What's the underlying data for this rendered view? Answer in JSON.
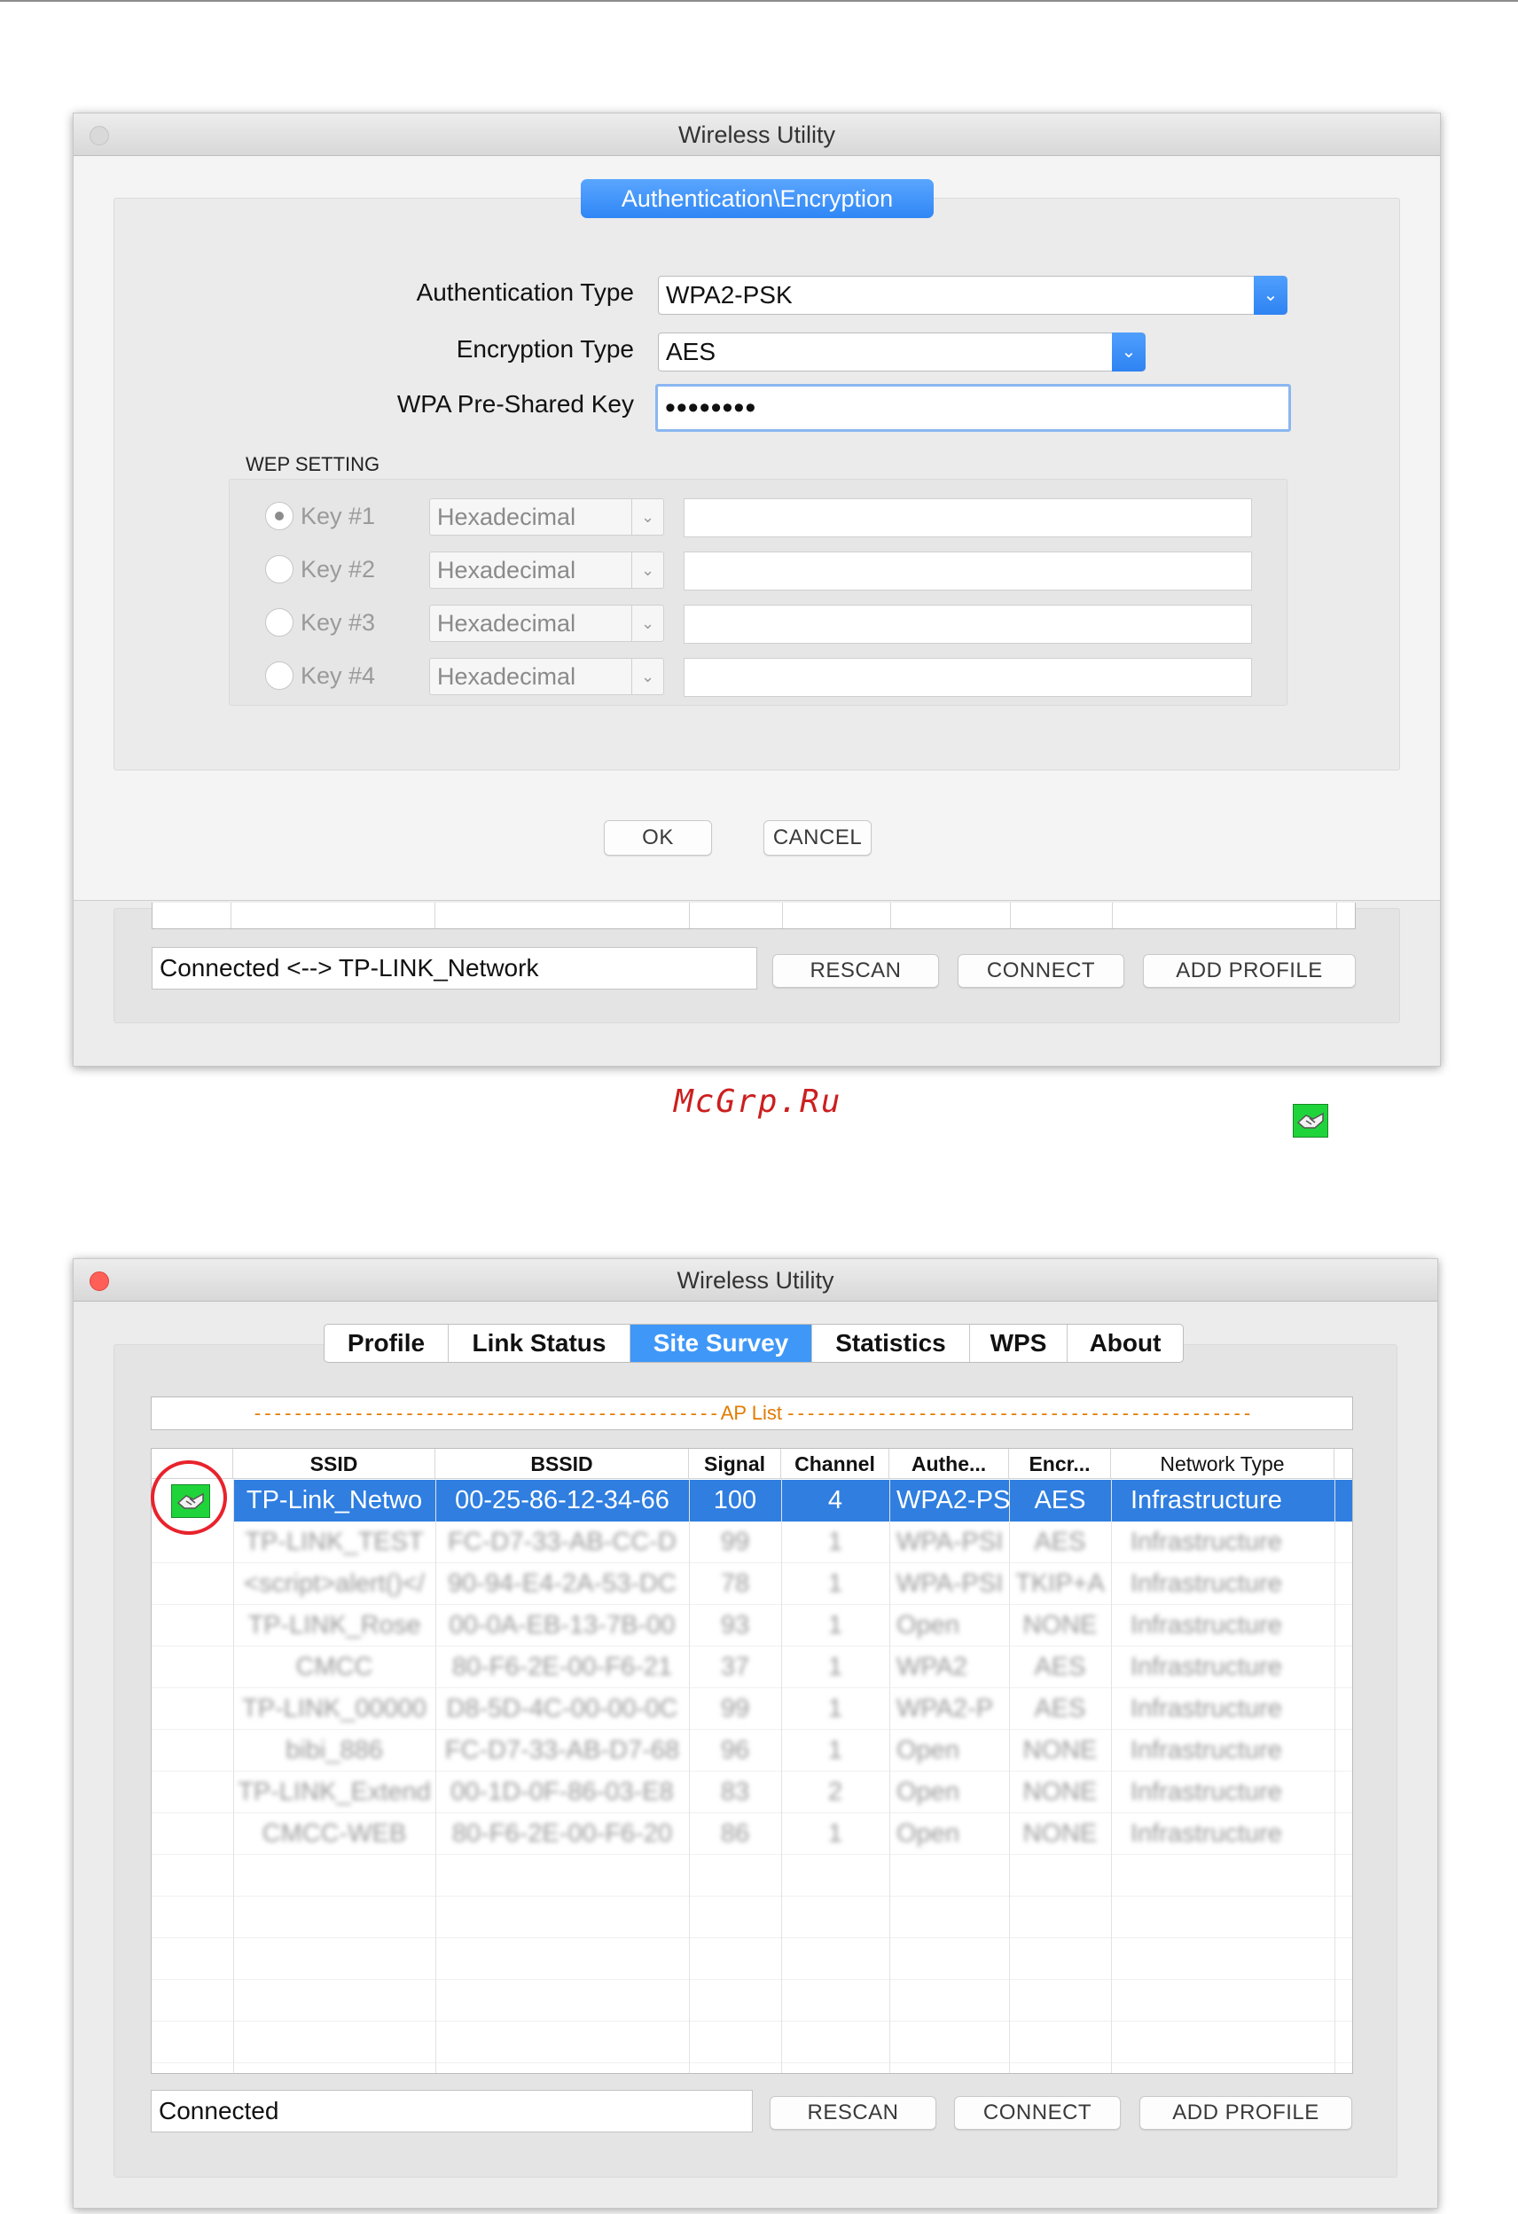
{
  "watermark": "McGrp.Ru",
  "auth_window": {
    "title": "Wireless Utility",
    "section_button": "Authentication\\Encryption",
    "fields": {
      "auth_type_label": "Authentication Type",
      "auth_type_value": "WPA2-PSK",
      "enc_type_label": "Encryption Type",
      "enc_type_value": "AES",
      "psk_label": "WPA Pre-Shared Key",
      "psk_value": "••••••••"
    },
    "wep": {
      "title": "WEP SETTING",
      "keys": [
        {
          "label": "Key #1",
          "format": "Hexadecimal",
          "selected": true,
          "value": ""
        },
        {
          "label": "Key #2",
          "format": "Hexadecimal",
          "selected": false,
          "value": ""
        },
        {
          "label": "Key #3",
          "format": "Hexadecimal",
          "selected": false,
          "value": ""
        },
        {
          "label": "Key #4",
          "format": "Hexadecimal",
          "selected": false,
          "value": ""
        }
      ]
    },
    "ok_label": "OK",
    "cancel_label": "CANCEL",
    "status_text": "Connected <--> TP-LINK_Network",
    "rescan_label": "RESCAN",
    "connect_label": "CONNECT",
    "add_profile_label": "ADD PROFILE"
  },
  "survey_window": {
    "title": "Wireless Utility",
    "tabs": [
      "Profile",
      "Link Status",
      "Site Survey",
      "Statistics",
      "WPS",
      "About"
    ],
    "active_tab": "Site Survey",
    "ap_list_label": "AP List",
    "columns": [
      "SSID",
      "BSSID",
      "Signal",
      "Channel",
      "Authe...",
      "Encr...",
      "Network Type"
    ],
    "rows": [
      {
        "connected": true,
        "ssid": "TP-Link_Netwo",
        "bssid": "00-25-86-12-34-66",
        "signal": "100",
        "channel": "4",
        "auth": "WPA2-PS",
        "enc": "AES",
        "type": "Infrastructure"
      },
      {
        "connected": false,
        "ssid": "TP-LINK_TEST",
        "bssid": "FC-D7-33-AB-CC-D",
        "signal": "99",
        "channel": "1",
        "auth": "WPA-PSI",
        "enc": "AES",
        "type": "Infrastructure"
      },
      {
        "connected": false,
        "ssid": "<script>alert()</",
        "bssid": "90-94-E4-2A-53-DC",
        "signal": "78",
        "channel": "1",
        "auth": "WPA-PSI",
        "enc": "TKIP+A",
        "type": "Infrastructure"
      },
      {
        "connected": false,
        "ssid": "TP-LINK_Rose",
        "bssid": "00-0A-EB-13-7B-00",
        "signal": "93",
        "channel": "1",
        "auth": "Open",
        "enc": "NONE",
        "type": "Infrastructure"
      },
      {
        "connected": false,
        "ssid": "CMCC",
        "bssid": "80-F6-2E-00-F6-21",
        "signal": "37",
        "channel": "1",
        "auth": "WPA2",
        "enc": "AES",
        "type": "Infrastructure"
      },
      {
        "connected": false,
        "ssid": "TP-LINK_00000",
        "bssid": "D8-5D-4C-00-00-0C",
        "signal": "99",
        "channel": "1",
        "auth": "WPA2-P",
        "enc": "AES",
        "type": "Infrastructure"
      },
      {
        "connected": false,
        "ssid": "bibi_886",
        "bssid": "FC-D7-33-AB-D7-68",
        "signal": "96",
        "channel": "1",
        "auth": "Open",
        "enc": "NONE",
        "type": "Infrastructure"
      },
      {
        "connected": false,
        "ssid": "TP-LINK_Extend",
        "bssid": "00-1D-0F-86-03-E8",
        "signal": "83",
        "channel": "2",
        "auth": "Open",
        "enc": "NONE",
        "type": "Infrastructure"
      },
      {
        "connected": false,
        "ssid": "CMCC-WEB",
        "bssid": "80-F6-2E-00-F6-20",
        "signal": "86",
        "channel": "1",
        "auth": "Open",
        "enc": "NONE",
        "type": "Infrastructure"
      }
    ],
    "status_text": "Connected",
    "rescan_label": "RESCAN",
    "connect_label": "CONNECT",
    "add_profile_label": "ADD PROFILE"
  },
  "colors": {
    "accent_blue": "#3f97f8",
    "selected_row": "#2f7ee0",
    "highlight_circle": "#e8232c",
    "connected_icon": "#1fd43a",
    "watermark": "#cc1f1f",
    "ap_list_text": "#e07b00"
  }
}
